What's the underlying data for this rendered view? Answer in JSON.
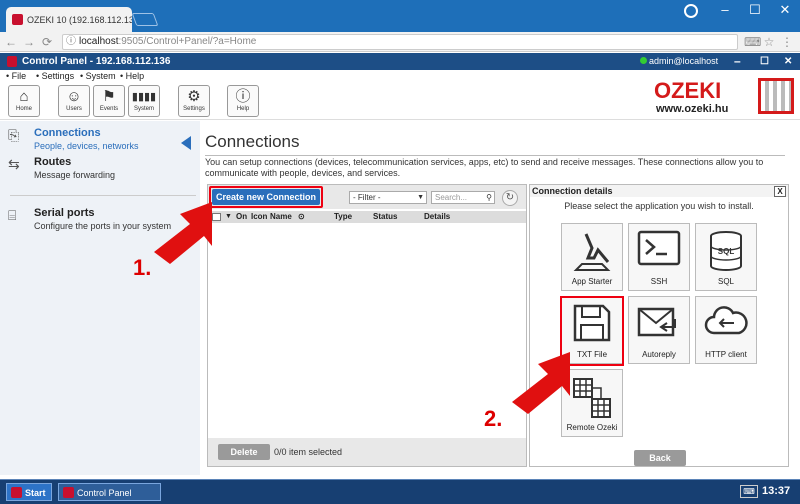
{
  "browser": {
    "tab_title": "OZEKI 10 (192.168.112.136",
    "tab_close": "×",
    "url_host": "localhost",
    "url_rest": ":9505/Control+Panel/?a=Home",
    "minimize": "–",
    "restore": "☐",
    "close": "✕"
  },
  "app": {
    "header_title": "Control Panel - 192.168.112.136",
    "user": "admin@localhost",
    "brand": "OZEKI",
    "brand_url": "www.ozeki.hu",
    "menu": [
      "File",
      "Settings",
      "System",
      "Help"
    ],
    "toolbar": [
      {
        "label": "Home",
        "icon": "home-icon"
      },
      {
        "label": "Users",
        "icon": "user-icon"
      },
      {
        "label": "Events",
        "icon": "flag-icon"
      },
      {
        "label": "System",
        "icon": "bars-icon"
      },
      {
        "label": "Settings",
        "icon": "gear-icon"
      },
      {
        "label": "Help",
        "icon": "info-icon"
      }
    ]
  },
  "sidebar": {
    "items": [
      {
        "title": "Connections",
        "subtitle": "People, devices, networks"
      },
      {
        "title": "Routes",
        "subtitle": "Message forwarding"
      },
      {
        "title": "Serial ports",
        "subtitle": "Configure the ports in your system"
      }
    ]
  },
  "main": {
    "title": "Connections",
    "description": "You can setup connections (devices, telecommunication services, apps, etc) to send and receive messages. These connections allow you to communicate with people, devices, and services.",
    "create_button": "Create new Connection",
    "filter": "- Filter -",
    "search_placeholder": "Search...",
    "columns": [
      "On",
      "Icon",
      "Name",
      "Type",
      "Status",
      "Details"
    ],
    "delete_button": "Delete",
    "selected_count": "0/0 item selected"
  },
  "details": {
    "header": "Connection details",
    "close": "X",
    "instruction": "Please select the application you wish to install.",
    "apps": [
      "App Starter",
      "SSH",
      "SQL",
      "TXT File",
      "Autoreply",
      "HTTP client",
      "Remote Ozeki"
    ],
    "back_button": "Back"
  },
  "annotations": {
    "step1": "1.",
    "step2": "2."
  },
  "colors": {
    "highlight": "#e01010",
    "header_blue": "#1d4e86",
    "button_blue": "#2a6ebb"
  },
  "taskbar": {
    "start": "Start",
    "control_panel": "Control Panel",
    "time": "13:37"
  }
}
